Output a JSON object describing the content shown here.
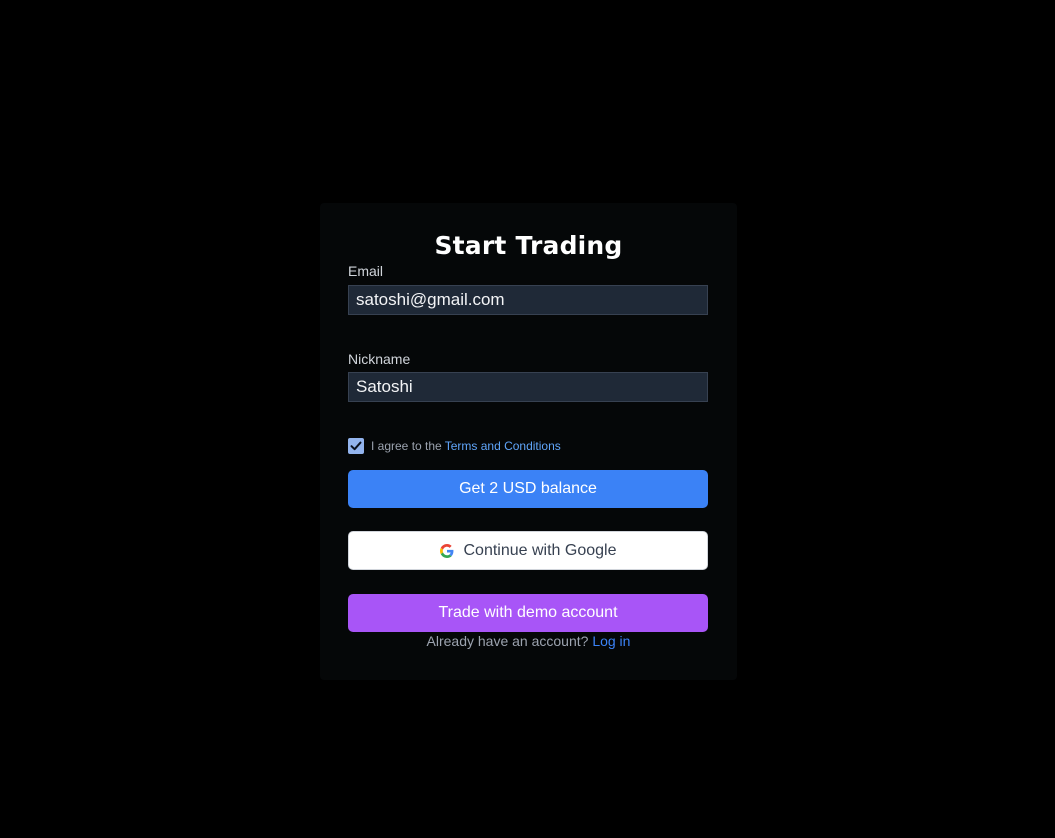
{
  "form": {
    "title": "Start Trading",
    "email": {
      "label": "Email",
      "value": "satoshi@gmail.com"
    },
    "nickname": {
      "label": "Nickname",
      "value": "Satoshi"
    },
    "terms": {
      "checked": true,
      "text": "I agree to the",
      "link_text": "Terms and Conditions"
    },
    "buttons": {
      "balance_label": "Get 2 USD balance",
      "google_label": "Continue with Google",
      "demo_label": "Trade with demo account"
    },
    "login": {
      "prompt": "Already have an account?",
      "link_text": "Log in"
    }
  },
  "colors": {
    "background": "#000000",
    "card": "#050708",
    "input_bg": "#1f2937",
    "primary_blue": "#3b82f6",
    "demo_purple": "#a855f7",
    "link_blue": "#60a5fa"
  },
  "icons": {
    "checkbox": "checkmark-icon",
    "google": "google-g-icon"
  }
}
